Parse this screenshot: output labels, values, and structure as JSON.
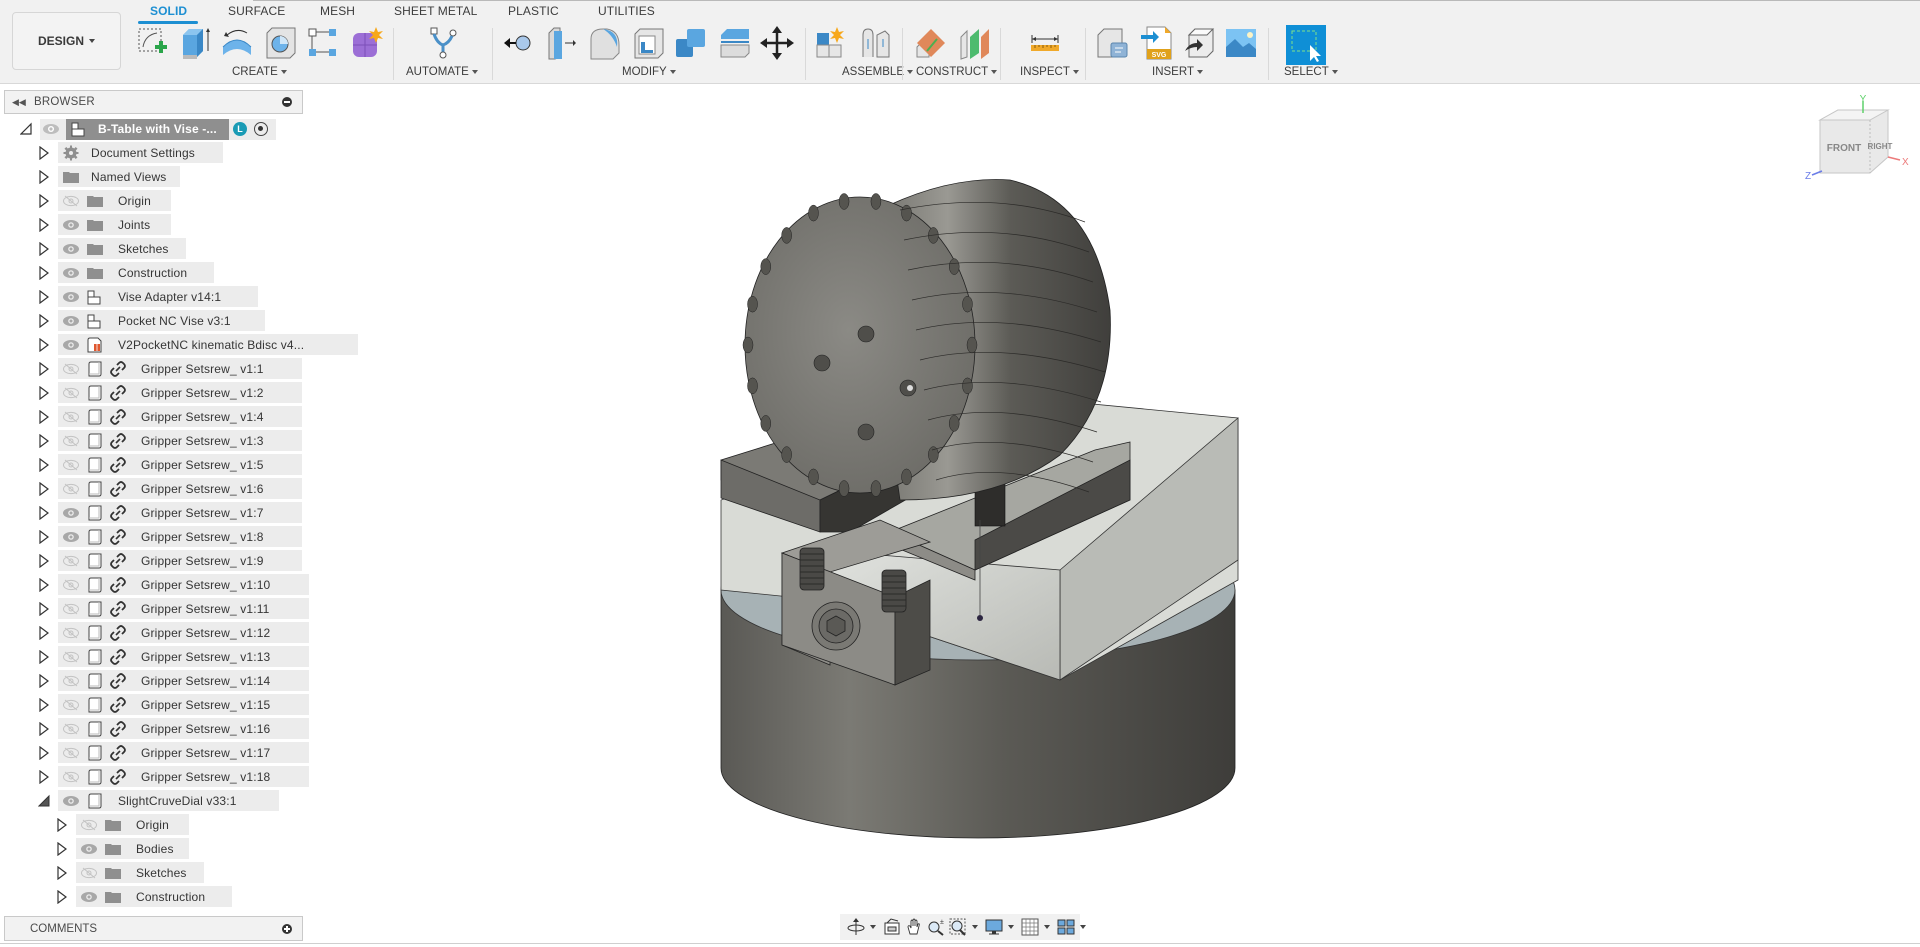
{
  "workspace": {
    "label": "DESIGN"
  },
  "tabs": [
    {
      "label": "SOLID",
      "active": true
    },
    {
      "label": "SURFACE",
      "active": false
    },
    {
      "label": "MESH",
      "active": false
    },
    {
      "label": "SHEET METAL",
      "active": false
    },
    {
      "label": "PLASTIC",
      "active": false
    },
    {
      "label": "UTILITIES",
      "active": false
    }
  ],
  "groups": {
    "create": {
      "label": "CREATE",
      "tools": [
        "create-sketch-icon",
        "extrude-icon",
        "revolve-icon",
        "hole-icon",
        "pattern-icon",
        "create-form-icon"
      ]
    },
    "automate": {
      "label": "AUTOMATE",
      "tools": [
        "automate-icon"
      ]
    },
    "modify": {
      "label": "MODIFY",
      "tools": [
        "press-pull-icon",
        "offset-face-icon",
        "fillet-icon",
        "shell-icon",
        "combine-icon",
        "split-body-icon",
        "move-icon"
      ]
    },
    "assemble": {
      "label": "ASSEMBLE",
      "tools": [
        "new-component-icon",
        "joint-icon"
      ]
    },
    "construct": {
      "label": "CONSTRUCT",
      "tools": [
        "offset-plane-icon",
        "midplane-icon"
      ]
    },
    "inspect": {
      "label": "INSPECT",
      "tools": [
        "measure-icon"
      ]
    },
    "insert": {
      "label": "INSERT",
      "tools": [
        "insert-derive-icon",
        "insert-svg-icon",
        "insert-mesh-icon",
        "canvas-icon"
      ]
    },
    "select": {
      "label": "SELECT",
      "tools": [
        "select-window-icon"
      ]
    }
  },
  "browser": {
    "title": "BROWSER",
    "root": {
      "label": "B-Table with Vise -...",
      "badge": "L",
      "expanded": true
    },
    "items": [
      {
        "label": "Document Settings",
        "icon": "gear",
        "visible": null,
        "link": false,
        "indent": 1
      },
      {
        "label": "Named Views",
        "icon": "folder",
        "visible": null,
        "link": false,
        "indent": 1
      },
      {
        "label": "Origin",
        "icon": "folder",
        "visible": false,
        "link": false,
        "indent": 1
      },
      {
        "label": "Joints",
        "icon": "folder",
        "visible": true,
        "link": false,
        "indent": 1
      },
      {
        "label": "Sketches",
        "icon": "folder",
        "visible": true,
        "link": false,
        "indent": 1
      },
      {
        "label": "Construction",
        "icon": "folder",
        "visible": true,
        "link": false,
        "indent": 1
      },
      {
        "label": "Vise Adapter v14:1",
        "icon": "assembly",
        "visible": true,
        "link": false,
        "indent": 1
      },
      {
        "label": "Pocket NC Vise v3:1",
        "icon": "assembly",
        "visible": true,
        "link": false,
        "indent": 1
      },
      {
        "label": "V2PocketNC kinematic Bdisc v4...",
        "icon": "pinned",
        "visible": true,
        "link": false,
        "indent": 1
      },
      {
        "label": "Gripper Setsrew_ v1:1",
        "icon": "component",
        "visible": false,
        "link": true,
        "indent": 1
      },
      {
        "label": "Gripper Setsrew_ v1:2",
        "icon": "component",
        "visible": false,
        "link": true,
        "indent": 1
      },
      {
        "label": "Gripper Setsrew_ v1:4",
        "icon": "component",
        "visible": false,
        "link": true,
        "indent": 1
      },
      {
        "label": "Gripper Setsrew_ v1:3",
        "icon": "component",
        "visible": false,
        "link": true,
        "indent": 1
      },
      {
        "label": "Gripper Setsrew_ v1:5",
        "icon": "component",
        "visible": false,
        "link": true,
        "indent": 1
      },
      {
        "label": "Gripper Setsrew_ v1:6",
        "icon": "component",
        "visible": false,
        "link": true,
        "indent": 1
      },
      {
        "label": "Gripper Setsrew_ v1:7",
        "icon": "component",
        "visible": true,
        "link": true,
        "indent": 1
      },
      {
        "label": "Gripper Setsrew_ v1:8",
        "icon": "component",
        "visible": true,
        "link": true,
        "indent": 1
      },
      {
        "label": "Gripper Setsrew_ v1:9",
        "icon": "component",
        "visible": false,
        "link": true,
        "indent": 1
      },
      {
        "label": "Gripper Setsrew_ v1:10",
        "icon": "component",
        "visible": false,
        "link": true,
        "indent": 1
      },
      {
        "label": "Gripper Setsrew_ v1:11",
        "icon": "component",
        "visible": false,
        "link": true,
        "indent": 1
      },
      {
        "label": "Gripper Setsrew_ v1:12",
        "icon": "component",
        "visible": false,
        "link": true,
        "indent": 1
      },
      {
        "label": "Gripper Setsrew_ v1:13",
        "icon": "component",
        "visible": false,
        "link": true,
        "indent": 1
      },
      {
        "label": "Gripper Setsrew_ v1:14",
        "icon": "component",
        "visible": false,
        "link": true,
        "indent": 1
      },
      {
        "label": "Gripper Setsrew_ v1:15",
        "icon": "component",
        "visible": false,
        "link": true,
        "indent": 1
      },
      {
        "label": "Gripper Setsrew_ v1:16",
        "icon": "component",
        "visible": false,
        "link": true,
        "indent": 1
      },
      {
        "label": "Gripper Setsrew_ v1:17",
        "icon": "component",
        "visible": false,
        "link": true,
        "indent": 1
      },
      {
        "label": "Gripper Setsrew_ v1:18",
        "icon": "component",
        "visible": false,
        "link": true,
        "indent": 1
      },
      {
        "label": "SlightCruveDial v33:1",
        "icon": "component",
        "visible": true,
        "link": false,
        "indent": 1,
        "expanded": true
      },
      {
        "label": "Origin",
        "icon": "folder",
        "visible": false,
        "link": false,
        "indent": 2
      },
      {
        "label": "Bodies",
        "icon": "folder",
        "visible": true,
        "link": false,
        "indent": 2
      },
      {
        "label": "Sketches",
        "icon": "folder",
        "visible": false,
        "link": false,
        "indent": 2
      },
      {
        "label": "Construction",
        "icon": "folder",
        "visible": true,
        "link": false,
        "indent": 2
      }
    ]
  },
  "comments": {
    "title": "COMMENTS"
  },
  "viewcube": {
    "faces": [
      "FRONT",
      "RIGHT"
    ],
    "axes": {
      "x": "X",
      "y": "Y",
      "z": "Z"
    }
  },
  "navbar": {
    "tools": [
      "orbit-icon",
      "look-at-icon",
      "pan-icon",
      "zoom-icon",
      "fit-icon",
      "display-settings-icon",
      "grid-icon",
      "viewports-icon"
    ]
  },
  "colors": {
    "accent": "#1d8fd2",
    "toolbar_bg": "#f1f1f1",
    "root_row": "#8f8f8f",
    "row_bg": "#ececec",
    "model_dark": "#4e4d49",
    "model_light": "#c9cbc6"
  }
}
